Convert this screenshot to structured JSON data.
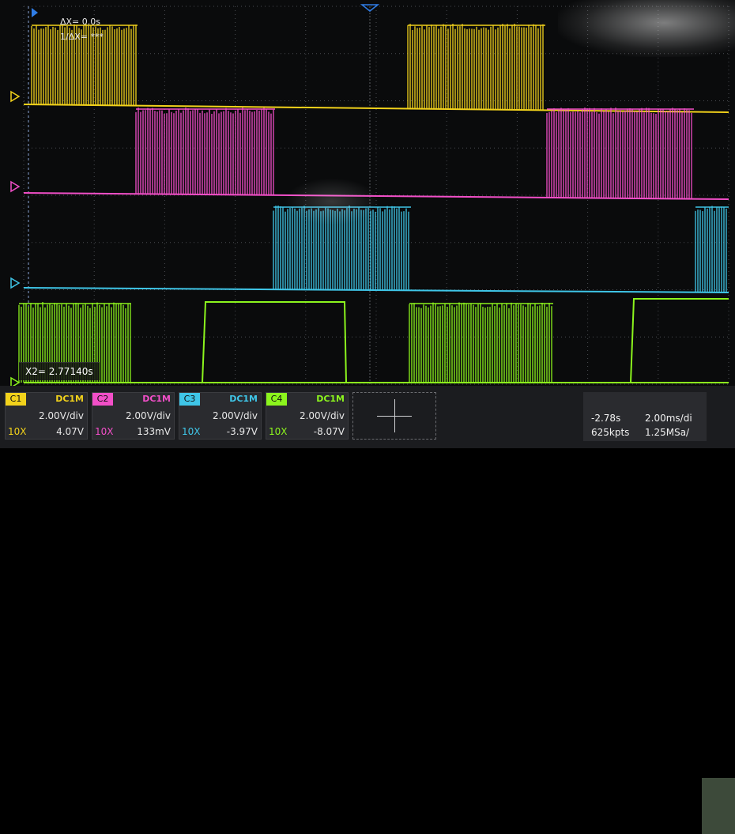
{
  "cursor": {
    "delta_x": "ΔX= 0.0s",
    "inv_delta_x": "1/ΔX= ***",
    "x2": "X2= 2.77140s"
  },
  "channels": [
    {
      "tag": "C1",
      "coupling": "DC1M",
      "vdiv": "2.00V/div",
      "probe": "10X",
      "offset": "4.07V",
      "color": "#f2d21b"
    },
    {
      "tag": "C2",
      "coupling": "DC1M",
      "vdiv": "2.00V/div",
      "probe": "10X",
      "offset": "133mV",
      "color": "#f24fc8"
    },
    {
      "tag": "C3",
      "coupling": "DC1M",
      "vdiv": "2.00V/div",
      "probe": "10X",
      "offset": "-3.97V",
      "color": "#3fc6e8"
    },
    {
      "tag": "C4",
      "coupling": "DC1M",
      "vdiv": "2.00V/div",
      "probe": "10X",
      "offset": "-8.07V",
      "color": "#8cf51d"
    }
  ],
  "timebase": {
    "delay": "-2.78s",
    "scale": "2.00ms/di",
    "memory": "625kpts",
    "sample_rate": "1.25MSa/"
  },
  "colors": {
    "grid": "#4a4c52",
    "background": "#0a0b0c",
    "trigger_marker": "#2f7de6"
  }
}
